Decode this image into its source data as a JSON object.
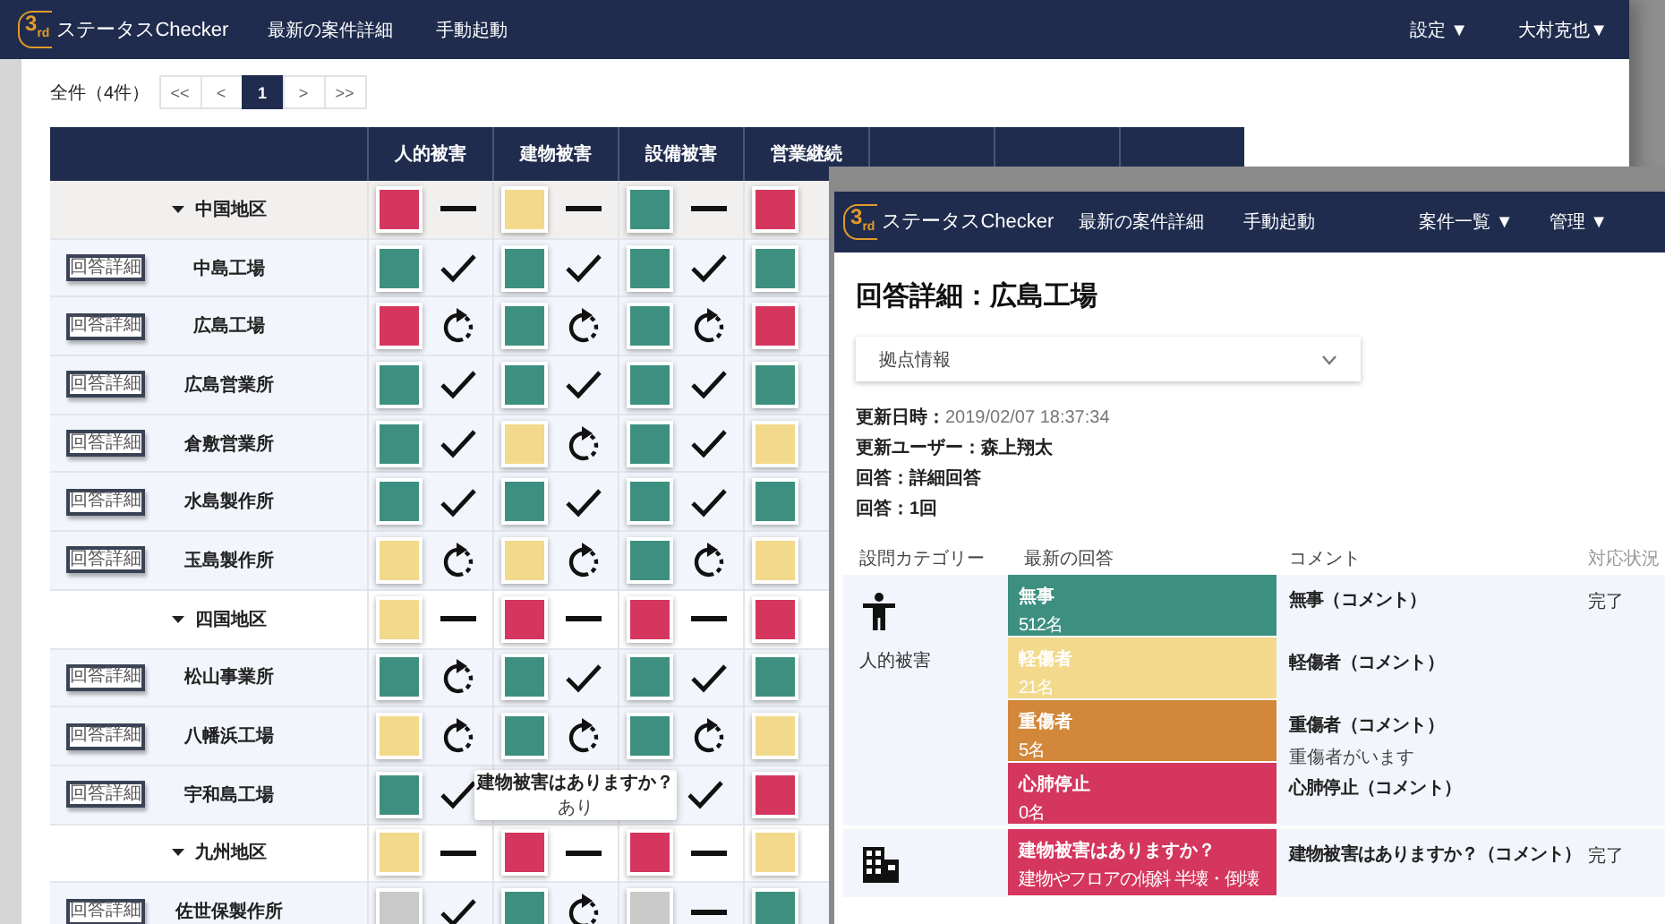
{
  "app": {
    "logo": "3$_{rd}$",
    "brand": "ステータスChecker",
    "nav": [
      "最新の案件詳細",
      "手動起動"
    ],
    "menus": [
      "設定 ▼",
      "大村克也▼"
    ]
  },
  "pagination": {
    "total": "全件（4件）",
    "buttons": [
      {
        "label": "<<",
        "selected": false
      },
      {
        "label": "<",
        "selected": false
      },
      {
        "label": "1",
        "selected": true
      },
      {
        "label": ">",
        "selected": false
      },
      {
        "label": ">>",
        "selected": false
      }
    ]
  },
  "table": {
    "columns": [
      "人的被害",
      "建物被害",
      "設備被害",
      "営業継続"
    ],
    "rows": [
      {
        "kind": "group",
        "name": "中国地区",
        "cells": [
          {
            "color": "#d4365e",
            "kind": "dash"
          },
          {
            "color": "#f2d98b",
            "kind": "dash"
          },
          {
            "color": "#3d9080",
            "kind": "dash"
          },
          {
            "color": "#d4365e"
          }
        ]
      },
      {
        "kind": "site",
        "button": "回答詳細",
        "name": "中島工場",
        "cells": [
          {
            "color": "#3d9080",
            "kind": "check"
          },
          {
            "color": "#3d9080",
            "kind": "check"
          },
          {
            "color": "#3d9080",
            "kind": "check"
          },
          {
            "color": "#3d9080"
          }
        ]
      },
      {
        "kind": "site",
        "button": "回答詳細",
        "name": "広島工場",
        "cells": [
          {
            "color": "#d4365e",
            "kind": "retry"
          },
          {
            "color": "#3d9080",
            "kind": "retry"
          },
          {
            "color": "#3d9080",
            "kind": "retry"
          },
          {
            "color": "#d4365e"
          }
        ]
      },
      {
        "kind": "site",
        "button": "回答詳細",
        "name": "広島営業所",
        "cells": [
          {
            "color": "#3d9080",
            "kind": "check"
          },
          {
            "color": "#3d9080",
            "kind": "check"
          },
          {
            "color": "#3d9080",
            "kind": "check"
          },
          {
            "color": "#3d9080"
          }
        ]
      },
      {
        "kind": "site",
        "button": "回答詳細",
        "name": "倉敷営業所",
        "cells": [
          {
            "color": "#3d9080",
            "kind": "check"
          },
          {
            "color": "#f2d98b",
            "kind": "retry"
          },
          {
            "color": "#3d9080",
            "kind": "check"
          },
          {
            "color": "#f2d98b"
          }
        ]
      },
      {
        "kind": "site",
        "button": "回答詳細",
        "name": "水島製作所",
        "cells": [
          {
            "color": "#3d9080",
            "kind": "check"
          },
          {
            "color": "#3d9080",
            "kind": "check"
          },
          {
            "color": "#3d9080",
            "kind": "check"
          },
          {
            "color": "#3d9080"
          }
        ]
      },
      {
        "kind": "site",
        "button": "回答詳細",
        "name": "玉島製作所",
        "cells": [
          {
            "color": "#f2d98b",
            "kind": "retry"
          },
          {
            "color": "#f2d98b",
            "kind": "retry"
          },
          {
            "color": "#3d9080",
            "kind": "retry"
          },
          {
            "color": "#f2d98b"
          }
        ]
      },
      {
        "kind": "group",
        "name": "四国地区",
        "cells": [
          {
            "color": "#f2d98b",
            "kind": "dash"
          },
          {
            "color": "#d4365e",
            "kind": "dash"
          },
          {
            "color": "#d4365e",
            "kind": "dash"
          },
          {
            "color": "#d4365e"
          }
        ]
      },
      {
        "kind": "site",
        "button": "回答詳細",
        "name": "松山事業所",
        "cells": [
          {
            "color": "#3d9080",
            "kind": "retry"
          },
          {
            "color": "#3d9080",
            "kind": "check"
          },
          {
            "color": "#3d9080",
            "kind": "check"
          },
          {
            "color": "#3d9080"
          }
        ]
      },
      {
        "kind": "site",
        "button": "回答詳細",
        "name": "八幡浜工場",
        "cells": [
          {
            "color": "#f2d98b",
            "kind": "retry"
          },
          {
            "color": "#3d9080",
            "kind": "retry"
          },
          {
            "color": "#3d9080",
            "kind": "retry"
          },
          {
            "color": "#f2d98b"
          }
        ]
      },
      {
        "kind": "site",
        "button": "回答詳細",
        "name": "宇和島工場",
        "cells": [
          {
            "color": "#3d9080",
            "kind": "check"
          },
          {},
          {
            "kind": "check"
          },
          {
            "color": "#d4365e"
          }
        ]
      },
      {
        "kind": "group",
        "name": "九州地区",
        "cells": [
          {
            "color": "#f2d98b",
            "kind": "dash"
          },
          {
            "color": "#d4365e",
            "kind": "dash"
          },
          {
            "color": "#d4365e",
            "kind": "dash"
          },
          {
            "color": "#f2d98b"
          }
        ]
      },
      {
        "kind": "site",
        "button": "回答詳細",
        "name": "佐世保製作所",
        "cells": [
          {
            "color": "#c9c9c9",
            "kind": "check"
          },
          {
            "color": "#3d9080",
            "kind": "retry"
          },
          {
            "color": "#c9c9c9",
            "kind": "dash"
          },
          {
            "color": "#3d9080"
          }
        ]
      }
    ]
  },
  "tooltip": {
    "title": "建物被害はありますか？",
    "value": "あり"
  },
  "detail_window": {
    "logo": "3$_{rd}$",
    "brand": "ステータスChecker",
    "nav": [
      "最新の案件詳細",
      "手動起動"
    ],
    "menus": [
      "案件一覧 ▼",
      "管理 ▼"
    ],
    "title": "回答詳細：広島工場",
    "accordion": {
      "label": "拠点情報",
      "expanded": false
    },
    "info": [
      {
        "label": "更新日時：",
        "value": "2019/02/07 18:37:34"
      },
      {
        "label": "更新ユーザー：",
        "value": "森上翔太"
      },
      {
        "label": "回答：",
        "value": "詳細回答"
      },
      {
        "label": "回答：",
        "value": "1回"
      }
    ],
    "columns": [
      "設問カテゴリー",
      "最新の回答",
      "コメント",
      "対応状況"
    ],
    "rows": [
      {
        "kind": "person",
        "category": "人的被害",
        "status": "完了",
        "answers": [
          {
            "title": "無事",
            "value": "512名",
            "color": "#3d9080",
            "comment": "無事（コメント）"
          },
          {
            "title": "軽傷者",
            "value": "21名",
            "color": "#f2d98b",
            "comment": "軽傷者（コメント）"
          },
          {
            "title": "重傷者",
            "value": "5名",
            "color": "#d2873a",
            "comment": "重傷者（コメント）",
            "note": "重傷者がいます"
          },
          {
            "title": "心肺停止",
            "value": "0名",
            "color": "#d4365e",
            "comment": "心肺停止（コメント）"
          }
        ]
      },
      {
        "kind": "building",
        "status": "完了",
        "answers": [
          {
            "title": "建物被害はありますか？",
            "value": "建物やフロアの傾斜 半壊・倒壊",
            "color": "#d4365e",
            "comment": "建物被害はありますか？（コメント）"
          }
        ]
      }
    ]
  }
}
